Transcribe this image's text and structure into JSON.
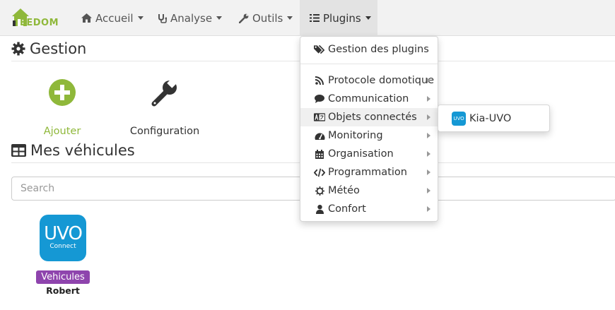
{
  "brand": {
    "logo_text_a": "EEDOM",
    "logo_accent": "#8fb83a"
  },
  "nav": {
    "items": [
      {
        "label": "Accueil",
        "icon": "home-icon"
      },
      {
        "label": "Analyse",
        "icon": "stethoscope-icon"
      },
      {
        "label": "Outils",
        "icon": "wrench-icon"
      },
      {
        "label": "Plugins",
        "icon": "tasks-icon"
      }
    ]
  },
  "gestion": {
    "title": "Gestion",
    "add_label": "Ajouter",
    "config_label": "Configuration",
    "add_color": "#8fb83a"
  },
  "vehicles": {
    "title": "Mes véhicules",
    "search_placeholder": "Search",
    "items": [
      {
        "logo_big": "UVO",
        "logo_small": "Connect",
        "badge": "Vehicules",
        "name": "Robert",
        "badge_color": "#8e44ad"
      }
    ]
  },
  "plugins_menu": {
    "manage": "Gestion des plugins",
    "categories": [
      {
        "label": "Protocole domotique",
        "icon": "rss-icon"
      },
      {
        "label": "Communication",
        "icon": "comment-icon"
      },
      {
        "label": "Objets connectés",
        "icon": "language-icon"
      },
      {
        "label": "Monitoring",
        "icon": "tachometer-icon"
      },
      {
        "label": "Organisation",
        "icon": "calendar-icon"
      },
      {
        "label": "Programmation",
        "icon": "code-icon"
      },
      {
        "label": "Météo",
        "icon": "sun-icon"
      },
      {
        "label": "Confort",
        "icon": "user-icon"
      }
    ],
    "submenu": {
      "label": "Kia-UVO",
      "logo": "UVO"
    }
  }
}
